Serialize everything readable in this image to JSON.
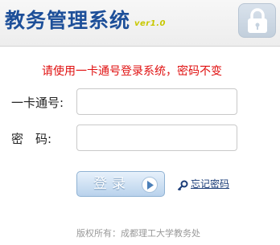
{
  "header": {
    "title": "教务管理系统",
    "version": "ver1.0"
  },
  "notice": "请使用一卡通号登录系统，密码不变",
  "form": {
    "card_label": "一卡通号:",
    "password_label": "密　码:",
    "card_value": "",
    "password_value": ""
  },
  "actions": {
    "login_label": "登录",
    "forgot_label": "忘记密码"
  },
  "footer": {
    "copyright": "版权所有：成都理工大学教务处"
  },
  "colors": {
    "title": "#1d4f99",
    "notice": "#e01010",
    "version": "#c8c800"
  }
}
